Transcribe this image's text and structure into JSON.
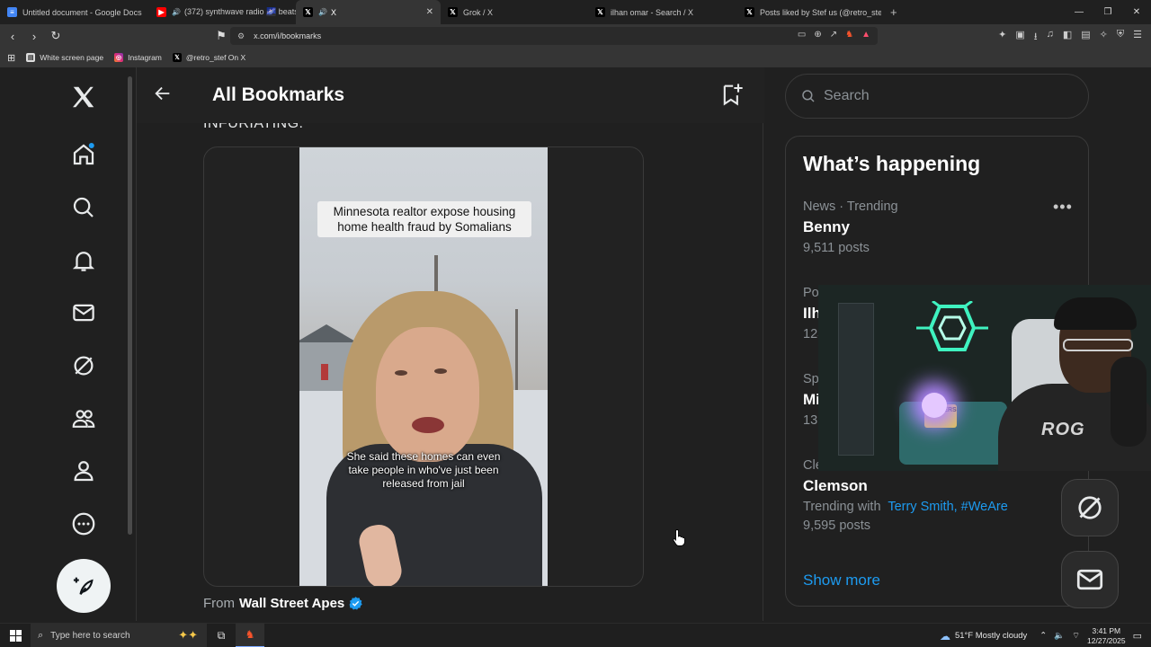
{
  "browser": {
    "tabs": [
      {
        "title": "Untitled document - Google Docs",
        "icon": "docs-icon",
        "active": false
      },
      {
        "title": "(372) synthwave radio 🌌 beats t",
        "icon": "youtube-icon",
        "active": false
      },
      {
        "title": "X",
        "icon": "x-icon",
        "active": true
      },
      {
        "title": "Grok / X",
        "icon": "x-icon",
        "active": false
      },
      {
        "title": "ilhan omar - Search / X",
        "icon": "x-icon",
        "active": false
      },
      {
        "title": "Posts liked by Stef us (@retro_stef) /",
        "icon": "x-icon",
        "active": false
      }
    ],
    "url": "x.com/i/bookmarks",
    "bookmarks": [
      {
        "label": "White screen page",
        "icon": "page-icon"
      },
      {
        "label": "Instagram",
        "icon": "instagram-icon"
      },
      {
        "label": "@retro_stef On X",
        "icon": "x-icon"
      }
    ]
  },
  "header": {
    "title": "All Bookmarks"
  },
  "post": {
    "cut_text": "INFURIATING.",
    "video_caption_top": "Minnesota realtor expose housing home health fraud by Somalians",
    "video_caption_bottom": "She said these homes can even take people in who've just been released from jail",
    "from_label": "From",
    "from_account": "Wall Street Apes"
  },
  "sidebar": {
    "search_placeholder": "Search",
    "happening_title": "What’s happening",
    "trends": [
      {
        "meta": "News · Trending",
        "name": "Benny",
        "posts": "9,511 posts"
      },
      {
        "meta": "Po",
        "name": "Ilh",
        "posts": "123"
      },
      {
        "meta": "Sp",
        "name": "Mi",
        "posts": "13."
      },
      {
        "meta": "Cle",
        "name": "Clemson",
        "trending_prefix": "Trending with",
        "tags": "Terry Smith, #WeAre",
        "posts": "9,595 posts"
      }
    ],
    "show_more": "Show more"
  },
  "webcam": {
    "pillow_text": "YES CERS",
    "shirt_text": "ROG"
  },
  "taskbar": {
    "search_placeholder": "Type here to search",
    "weather": "51°F  Mostly cloudy",
    "time": "3:41 PM",
    "date": "12/27/2025"
  },
  "colors": {
    "accent": "#1d9bf0",
    "background": "#202020",
    "text": "#e7e9ea"
  }
}
